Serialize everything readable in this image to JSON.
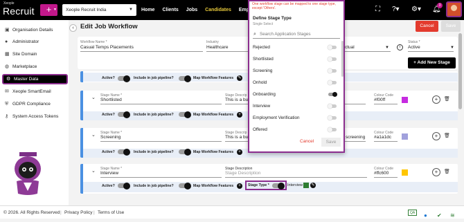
{
  "brand": {
    "small": "Xeople",
    "name": "Recruit"
  },
  "company_select": {
    "value": "Xeople Recruit India"
  },
  "nav": [
    "Home",
    "Clients",
    "Jobs",
    "Candidates",
    "Employ"
  ],
  "notifications": {
    "count": "3"
  },
  "sidebar": {
    "items": [
      {
        "label": "Organisation Details",
        "icon": "briefcase-icon"
      },
      {
        "label": "Administrator",
        "icon": "user-icon"
      },
      {
        "label": "Site Domain",
        "icon": "grid-icon"
      },
      {
        "label": "Marketplace",
        "icon": "globe-icon"
      },
      {
        "label": "Master Data",
        "icon": "settings-icon"
      },
      {
        "label": "Xeople SmartEmail",
        "icon": "email-icon"
      },
      {
        "label": "GDPR Compliance",
        "icon": "shield-icon"
      },
      {
        "label": "System Access Tokens",
        "icon": "key-icon"
      }
    ]
  },
  "page": {
    "title": "Edit Job Workflow",
    "cancel": "Cancel",
    "save": "Save"
  },
  "header": {
    "workflow_name_label": "Workflow Name *",
    "workflow_name": "Casual Temps Placements",
    "industry_label": "Industry",
    "industry": "Healthcare",
    "type_value": "ctual",
    "status_label": "Status *",
    "status": "Active",
    "add_stage": "+ Add New Stage"
  },
  "labels": {
    "stage_name": "Stage Name *",
    "stage_description": "Stage Description",
    "stage_desc_short": "Stage Descrip",
    "colour_code": "Colour Code",
    "active": "Active?",
    "include_pipeline": "Include in job pipeline?",
    "map_features": "Map Workflow Features",
    "stage_type": "Stage Type *"
  },
  "stages": [
    {
      "name": "Shortlisted",
      "description": "This is a bu",
      "colour": "#f00ff",
      "swatch": "#c62be0"
    },
    {
      "name": "Screening",
      "description": "This is a bu",
      "desc_tail": "screening",
      "colour": "#a1a1dc",
      "swatch": "#a1a1dc"
    },
    {
      "name": "Interview",
      "description": "Stage Description",
      "colour": "#ffc600",
      "swatch": "#ffc600",
      "stage_type": "Interview",
      "type_swatch": "#2e7d32"
    }
  ],
  "dropdown": {
    "warning": "One workflow stage can be mapped to one stage type, except 'Others'.",
    "title": "Define Stage Type",
    "subtitle": "Single Select",
    "search_placeholder": "Search Application Stages",
    "items": [
      "Rejected",
      "Shortlisted",
      "Screening",
      "Onhold",
      "Onboarding",
      "Interview",
      "Employment Verification",
      "Offered"
    ],
    "on_item": "Onboarding",
    "cancel": "Cancel",
    "save": "Save"
  },
  "footer": {
    "copyright": "© 2026. All Rights Reserved",
    "privacy": "Privacy Policy",
    "terms": "Terms of Use",
    "badge": "QA"
  },
  "colors": {
    "brand": "#c2188b",
    "accent_border": "#8b2d8e",
    "danger": "#e33b2e"
  }
}
